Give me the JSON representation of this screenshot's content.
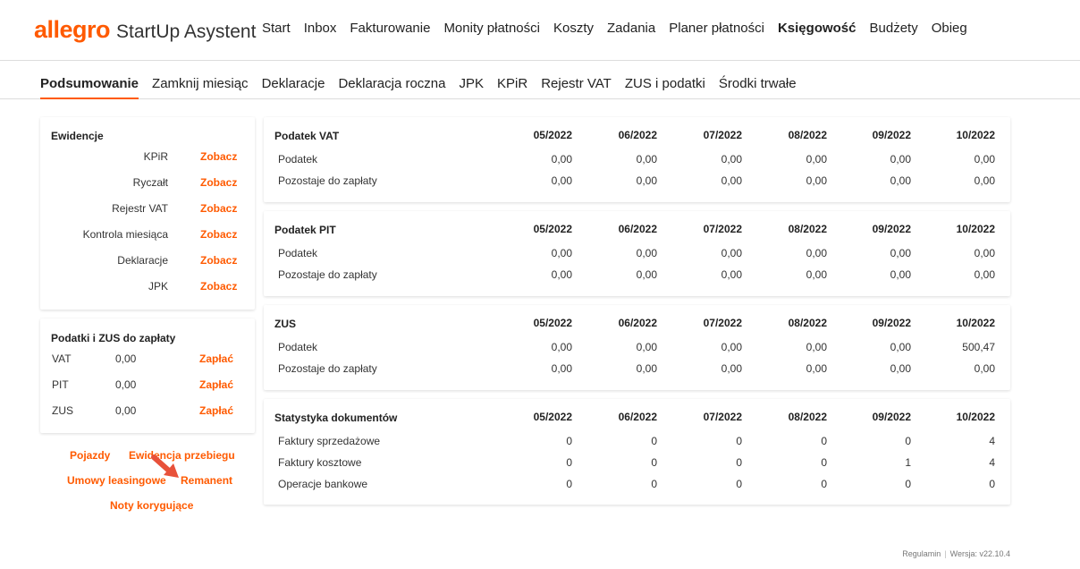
{
  "header": {
    "brand": "allegro",
    "product": "StartUp Asystent",
    "nav": [
      "Start",
      "Inbox",
      "Fakturowanie",
      "Monity płatności",
      "Koszty",
      "Zadania",
      "Planer płatności",
      "Księgowość",
      "Budżety",
      "Obieg"
    ],
    "active_nav": "Księgowość"
  },
  "subnav": {
    "items": [
      "Podsumowanie",
      "Zamknij miesiąc",
      "Deklaracje",
      "Deklaracja roczna",
      "JPK",
      "KPiR",
      "Rejestr VAT",
      "ZUS i podatki",
      "Środki trwałe"
    ],
    "active": "Podsumowanie"
  },
  "ewidencje": {
    "title": "Ewidencje",
    "rows": [
      {
        "label": "KPiR",
        "link": "Zobacz"
      },
      {
        "label": "Ryczałt",
        "link": "Zobacz"
      },
      {
        "label": "Rejestr VAT",
        "link": "Zobacz"
      },
      {
        "label": "Kontrola miesiąca",
        "link": "Zobacz"
      },
      {
        "label": "Deklaracje",
        "link": "Zobacz"
      },
      {
        "label": "JPK",
        "link": "Zobacz"
      }
    ]
  },
  "taxes_due": {
    "title": "Podatki i ZUS do zapłaty",
    "rows": [
      {
        "name": "VAT",
        "amount": "0,00",
        "link": "Zapłać"
      },
      {
        "name": "PIT",
        "amount": "0,00",
        "link": "Zapłać"
      },
      {
        "name": "ZUS",
        "amount": "0,00",
        "link": "Zapłać"
      }
    ]
  },
  "extra_links": {
    "pojazdy": "Pojazdy",
    "ewidencja_przebiegu": "Ewidencja przebiegu",
    "umowy_leasingowe": "Umowy leasingowe",
    "remanent": "Remanent",
    "noty_korygujace": "Noty korygujące"
  },
  "months": [
    "05/2022",
    "06/2022",
    "07/2022",
    "08/2022",
    "09/2022",
    "10/2022"
  ],
  "summary_tables": [
    {
      "title": "Podatek VAT",
      "rows": [
        {
          "label": "Podatek",
          "values": [
            "0,00",
            "0,00",
            "0,00",
            "0,00",
            "0,00",
            "0,00"
          ]
        },
        {
          "label": "Pozostaje do zapłaty",
          "values": [
            "0,00",
            "0,00",
            "0,00",
            "0,00",
            "0,00",
            "0,00"
          ]
        }
      ]
    },
    {
      "title": "Podatek PIT",
      "rows": [
        {
          "label": "Podatek",
          "values": [
            "0,00",
            "0,00",
            "0,00",
            "0,00",
            "0,00",
            "0,00"
          ]
        },
        {
          "label": "Pozostaje do zapłaty",
          "values": [
            "0,00",
            "0,00",
            "0,00",
            "0,00",
            "0,00",
            "0,00"
          ]
        }
      ]
    },
    {
      "title": "ZUS",
      "rows": [
        {
          "label": "Podatek",
          "values": [
            "0,00",
            "0,00",
            "0,00",
            "0,00",
            "0,00",
            "500,47"
          ]
        },
        {
          "label": "Pozostaje do zapłaty",
          "values": [
            "0,00",
            "0,00",
            "0,00",
            "0,00",
            "0,00",
            "0,00"
          ]
        }
      ]
    },
    {
      "title": "Statystyka dokumentów",
      "rows": [
        {
          "label": "Faktury sprzedażowe",
          "values": [
            "0",
            "0",
            "0",
            "0",
            "0",
            "4"
          ]
        },
        {
          "label": "Faktury kosztowe",
          "values": [
            "0",
            "0",
            "0",
            "0",
            "1",
            "4"
          ]
        },
        {
          "label": "Operacje bankowe",
          "values": [
            "0",
            "0",
            "0",
            "0",
            "0",
            "0"
          ]
        }
      ]
    }
  ],
  "footer": {
    "regulamin": "Regulamin",
    "version": "Wersja: v22.10.4"
  },
  "colors": {
    "accent": "#ff5a00"
  }
}
